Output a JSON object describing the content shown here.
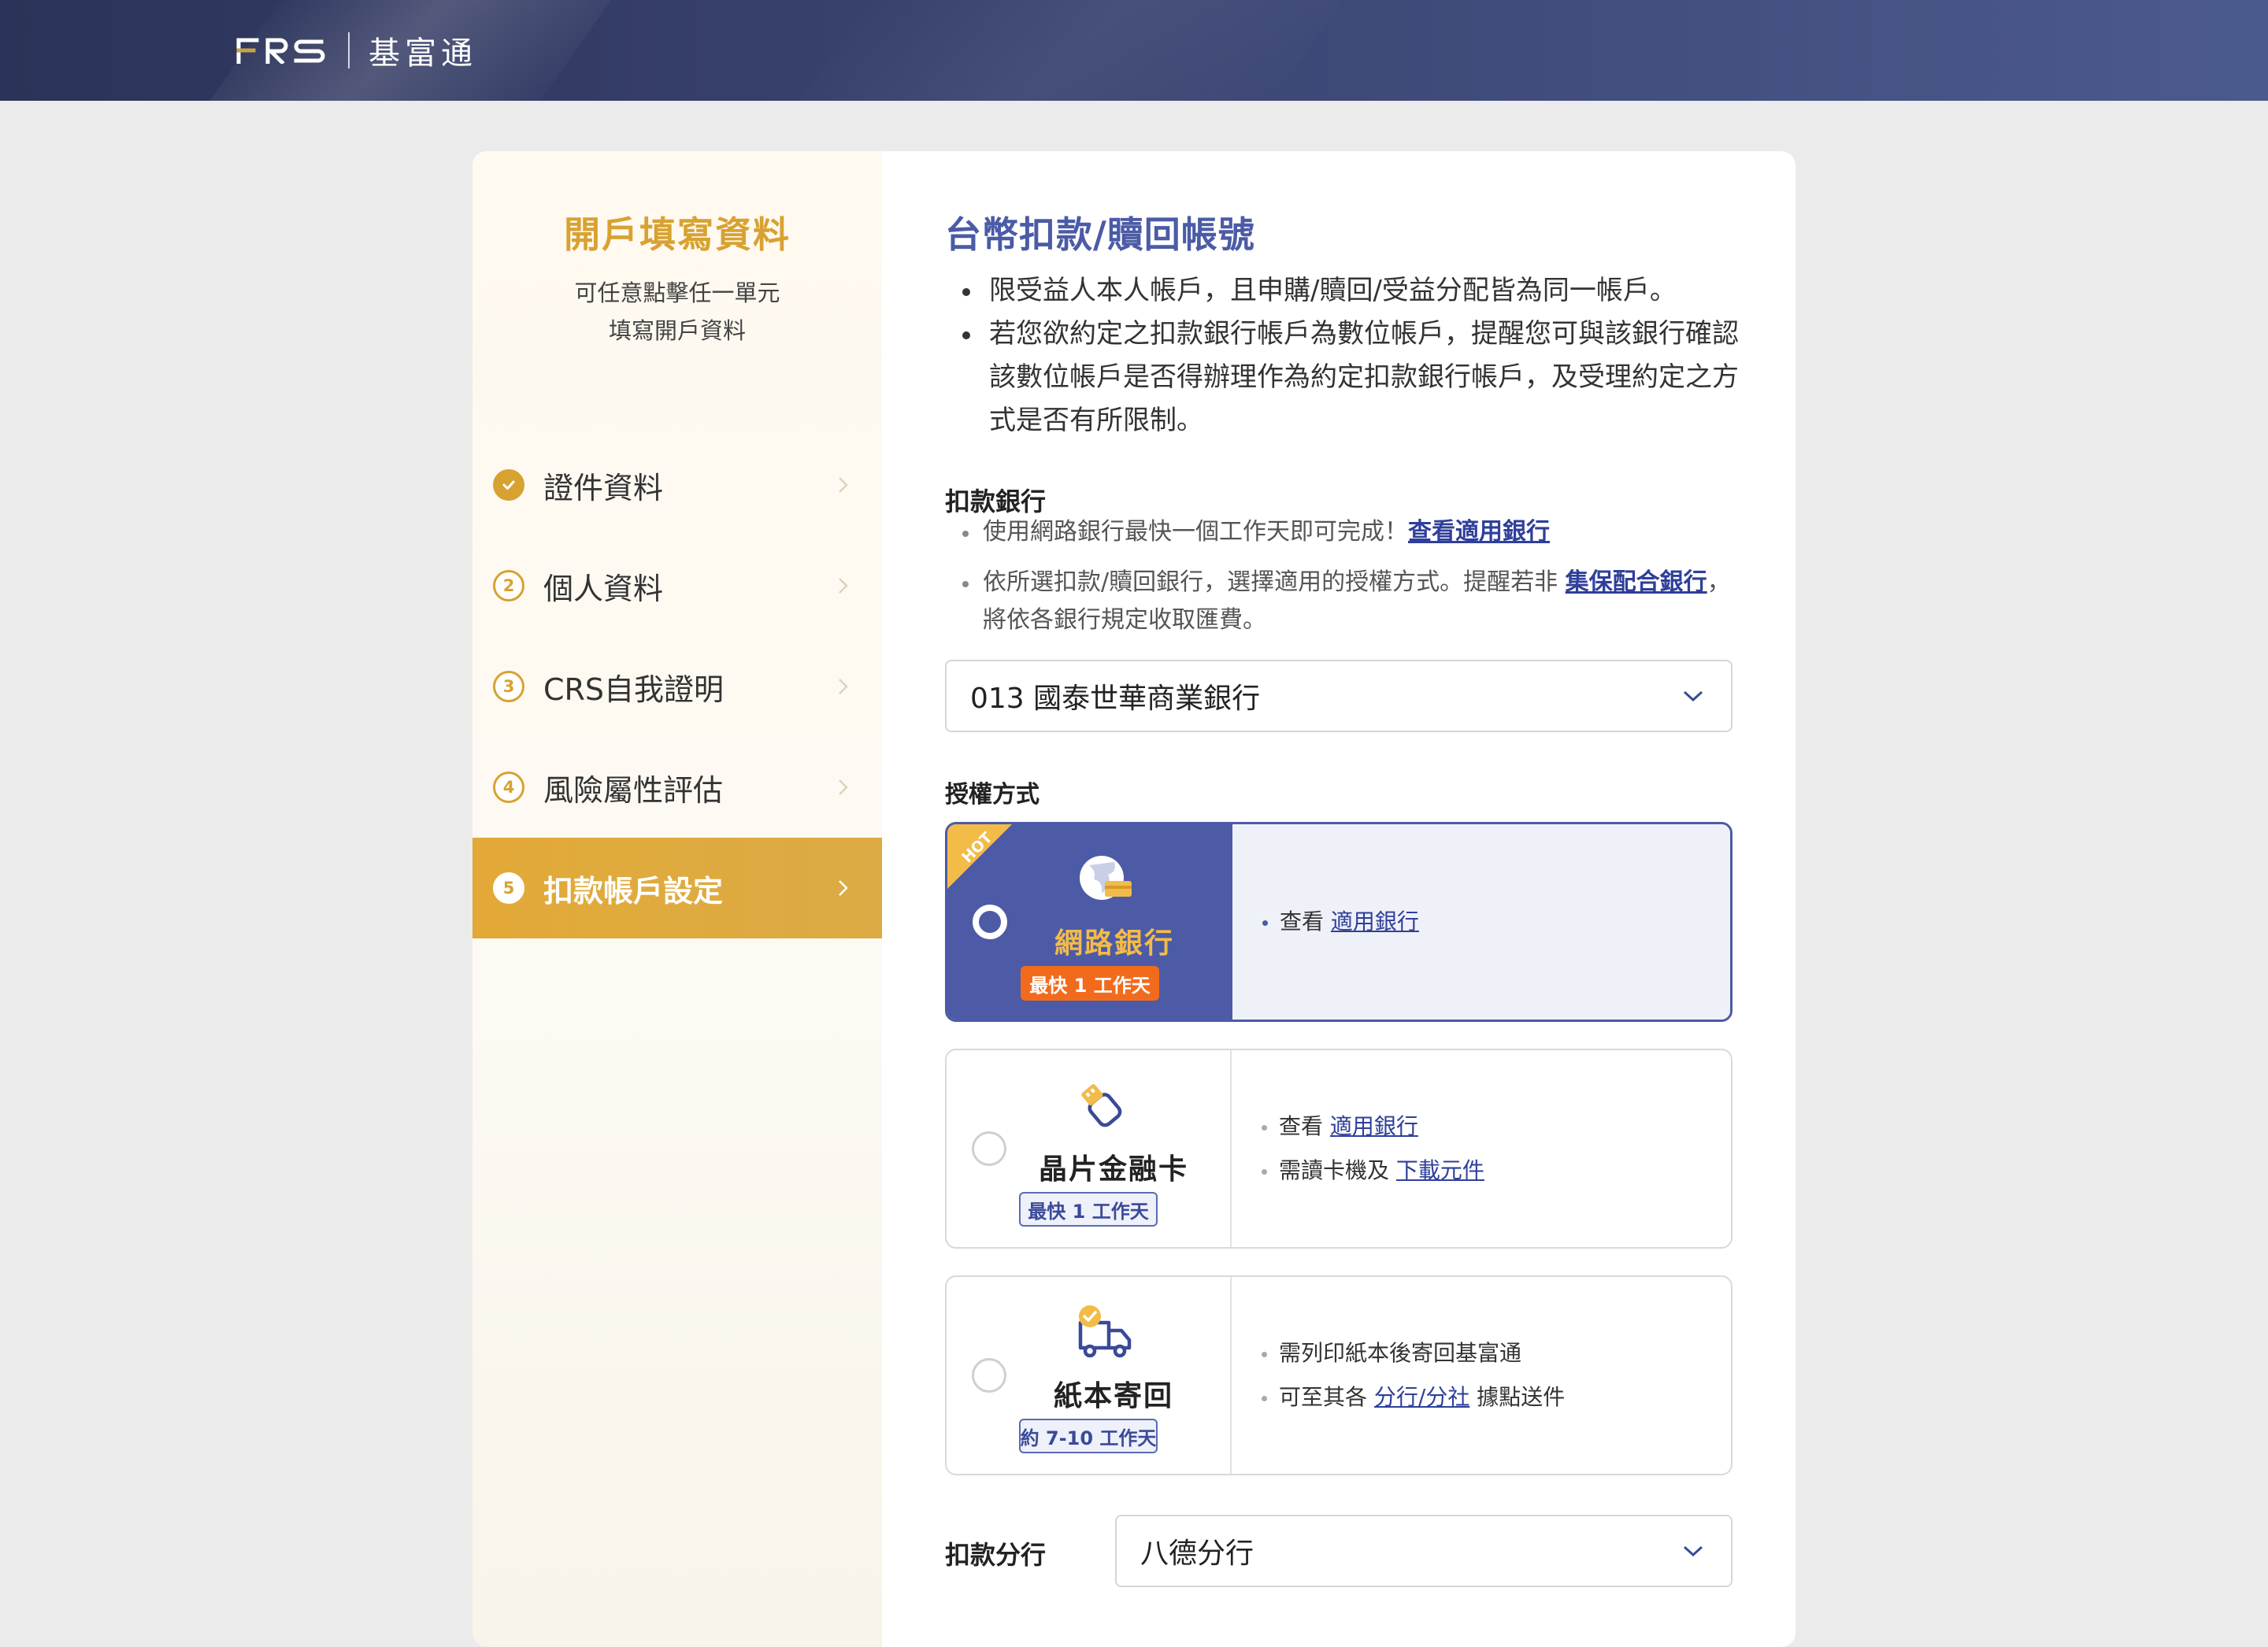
{
  "header": {
    "logo_text": "FRS",
    "logo_cn": "基富通"
  },
  "sidebar": {
    "title": "開戶填寫資料",
    "subtitle_line1": "可任意點擊任一單元",
    "subtitle_line2": "填寫開戶資料",
    "items": [
      {
        "step": "",
        "label": "證件資料",
        "status": "done"
      },
      {
        "step": "2",
        "label": "個人資料",
        "status": "todo"
      },
      {
        "step": "3",
        "label": "CRS自我證明",
        "status": "todo"
      },
      {
        "step": "4",
        "label": "風險屬性評估",
        "status": "todo"
      },
      {
        "step": "5",
        "label": "扣款帳戶設定",
        "status": "active"
      }
    ]
  },
  "main": {
    "title": "台幣扣款/贖回帳號",
    "rules": [
      "限受益人本人帳戶，且申購/贖回/受益分配皆為同一帳戶。",
      "若您欲約定之扣款銀行帳戶為數位帳戶，提醒您可與該銀行確認該數位帳戶是否得辦理作為約定扣款銀行帳戶，及受理約定之方式是否有所限制。"
    ],
    "bank_section": {
      "label": "扣款銀行",
      "note1_text": "使用網路銀行最快一個工作天即可完成！",
      "note1_link": "查看適用銀行",
      "note2_text": "依所選扣款/贖回銀行，選擇適用的授權方式。提醒若非",
      "note2_link": "集保配合銀行",
      "note2_tail": "，將依各銀行規定收取匯費。",
      "selected_bank": "013 國泰世華商業銀行"
    },
    "auth_section": {
      "label": "授權方式",
      "hot_label": "HOT",
      "options": [
        {
          "name": "網路銀行",
          "pill": "最快 1 工作天",
          "icon": "online-bank-icon",
          "line1_prefix": "查看",
          "line1_link": "適用銀行"
        },
        {
          "name": "晶片金融卡",
          "pill": "最快 1 工作天",
          "icon": "chip-card-icon",
          "line1_prefix": "查看",
          "line1_link": "適用銀行",
          "line2_prefix": "需讀卡機及",
          "line2_link": "下載元件"
        },
        {
          "name": "紙本寄回",
          "pill": "約 7-10 工作天",
          "icon": "delivery-truck-icon",
          "line1_text": "需列印紙本後寄回基富通",
          "line2_prefix": "可至其各",
          "line2_link": "分行/分社",
          "line2_suffix": "據點送件"
        }
      ],
      "selected_index": 0
    },
    "branch_section": {
      "label": "扣款分行",
      "selected_branch": "八德分行"
    }
  },
  "colors": {
    "brand_gold": "#d8a231",
    "brand_navy": "#4b5ba6",
    "hot_orange": "#f26b1d"
  }
}
